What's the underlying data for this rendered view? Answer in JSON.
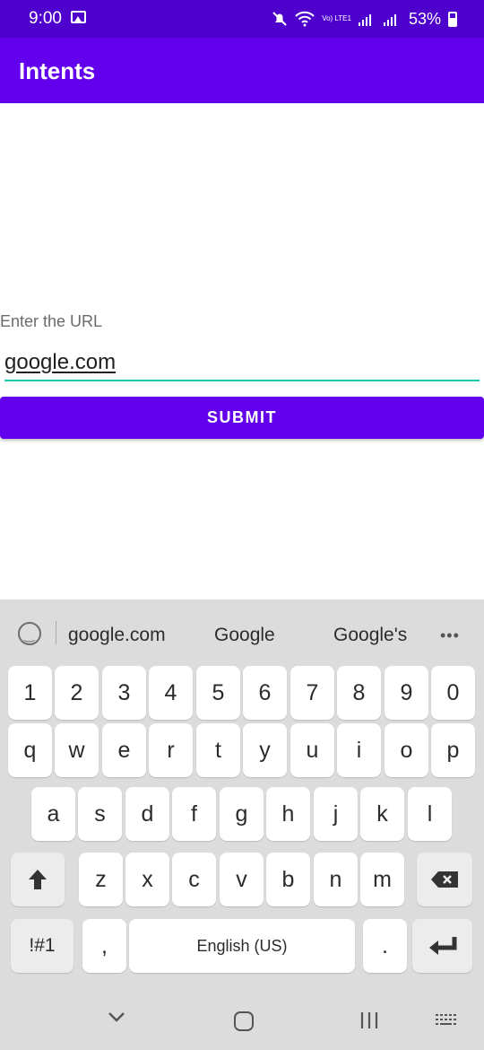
{
  "status_bar": {
    "time": "9:00",
    "battery_percent": "53%",
    "network_label": "Vo) LTE1"
  },
  "app_bar": {
    "title": "Intents"
  },
  "form": {
    "label": "Enter the URL",
    "input_value": "google.com",
    "submit_label": "SUBMIT"
  },
  "keyboard": {
    "suggestions": [
      "google.com",
      "Google",
      "Google's"
    ],
    "number_row": [
      "1",
      "2",
      "3",
      "4",
      "5",
      "6",
      "7",
      "8",
      "9",
      "0"
    ],
    "row_q": [
      "q",
      "w",
      "e",
      "r",
      "t",
      "y",
      "u",
      "i",
      "o",
      "p"
    ],
    "row_a": [
      "a",
      "s",
      "d",
      "f",
      "g",
      "h",
      "j",
      "k",
      "l"
    ],
    "row_z": [
      "z",
      "x",
      "c",
      "v",
      "b",
      "n",
      "m"
    ],
    "symbols_label": "!#1",
    "comma": ",",
    "space_label": "English (US)",
    "period": "."
  },
  "colors": {
    "status_bar": "#4e00cc",
    "app_bar": "#6200ee",
    "accent": "#1ec8b0"
  },
  "icons": {
    "gallery": "image-icon",
    "mute": "mute-icon",
    "wifi": "wifi-icon",
    "signal": "signal-icon",
    "battery": "battery-icon",
    "shift": "shift-icon",
    "backspace": "backspace-icon",
    "enter": "enter-icon",
    "sticker": "sticker-icon",
    "more": "more-icon",
    "nav_back": "nav-back-icon",
    "nav_home": "nav-home-icon",
    "nav_recent": "nav-recent-icon",
    "nav_keyboard": "nav-keyboard-icon"
  }
}
